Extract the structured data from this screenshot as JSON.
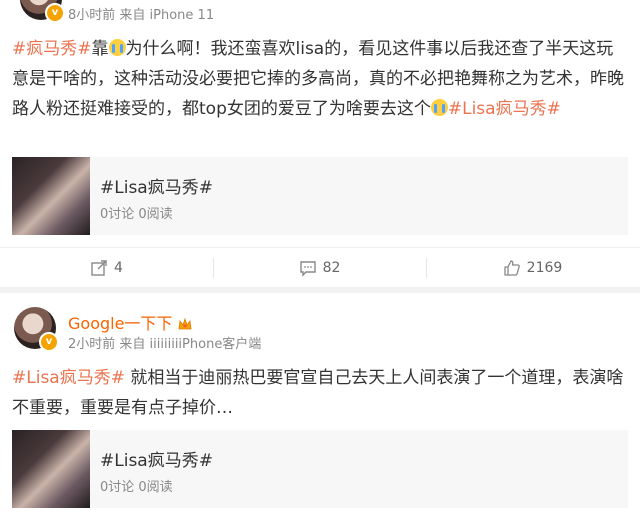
{
  "posts": [
    {
      "username": "",
      "meta": "8小时前 来自 iPhone 11",
      "content": {
        "tag1": "#疯马秀#",
        "text1": "靠",
        "text2": "为什么啊！我还蛮喜欢lisa的，看见这件事以后我还查了半天这玩意是干啥的，这种活动没必要把它捧的多高尚，真的不必把艳舞称之为艺术，昨晚路人粉还挺难接受的，都top女团的爱豆了为啥要去这个",
        "tag2": "#Lisa疯马秀#"
      },
      "card": {
        "title": "#Lisa疯马秀#",
        "sub": "0讨论 0阅读"
      },
      "actions": {
        "repost": "4",
        "comment": "82",
        "like": "2169"
      }
    },
    {
      "username": "Google一下下",
      "meta": "2小时前 来自 iiiiiiiiiPhone客户端",
      "content": {
        "tag1": "#Lisa疯马秀#",
        "text1": " 就相当于迪丽热巴要官宣自己去天上人间表演了一个道理，表演啥不重要，重要是有点子掉价…"
      },
      "card": {
        "title": "#Lisa疯马秀#",
        "sub": "0讨论 0阅读"
      }
    }
  ],
  "icons": {
    "repost": "repost-icon",
    "comment": "comment-icon",
    "like": "like-icon",
    "verified": "verified-badge-icon",
    "crown": "crown-icon"
  },
  "colors": {
    "hashtag": "#eb7350",
    "username": "#f86400",
    "verified": "#f4a300"
  }
}
